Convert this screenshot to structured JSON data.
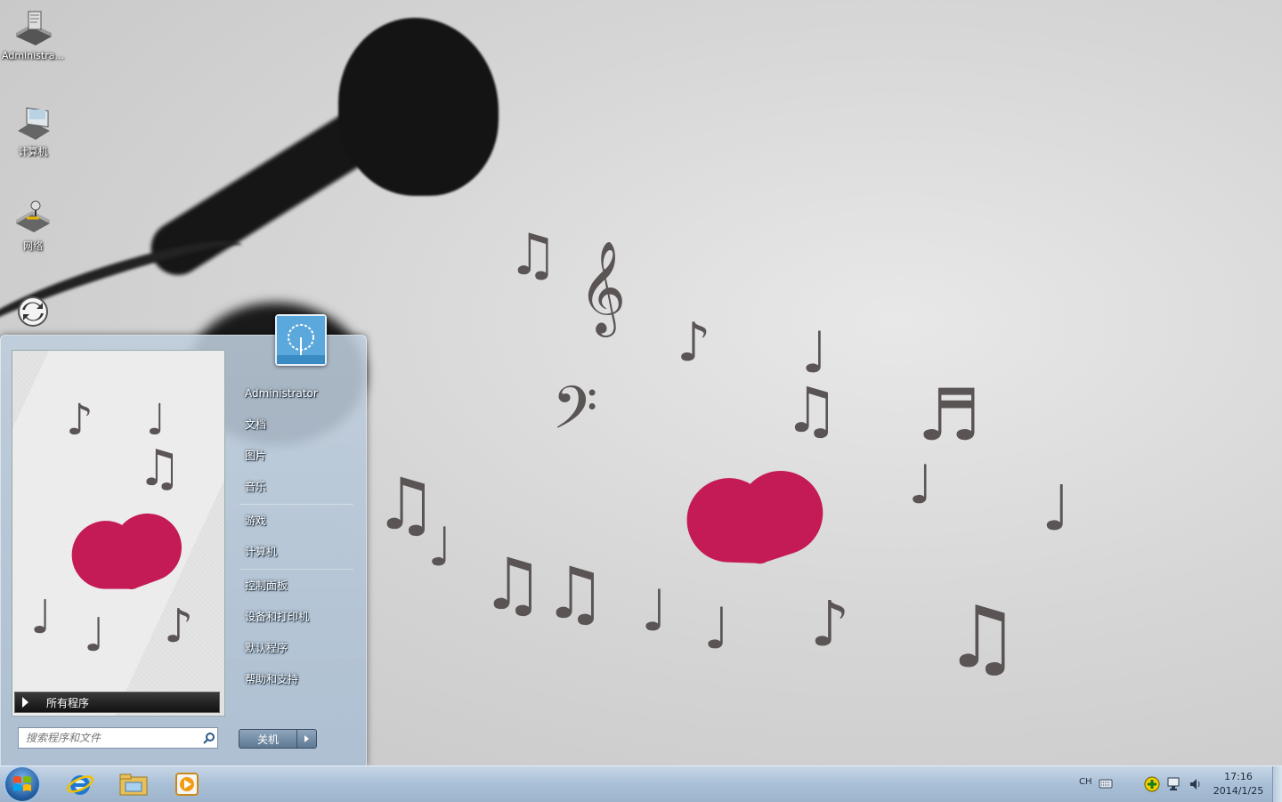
{
  "desktop": {
    "icons": [
      {
        "label": "Administra...",
        "icon": "user-folder-icon"
      },
      {
        "label": "计算机",
        "icon": "computer-icon"
      },
      {
        "label": "网络",
        "icon": "network-icon"
      },
      {
        "label": "",
        "icon": "sync-icon"
      }
    ]
  },
  "start_menu": {
    "user_name": "Administrator",
    "items": [
      "文档",
      "图片",
      "音乐",
      "游戏",
      "计算机",
      "控制面板",
      "设备和打印机",
      "默认程序",
      "帮助和支持"
    ],
    "all_programs_label": "所有程序",
    "search_placeholder": "搜索程序和文件",
    "shutdown_label": "关机"
  },
  "taskbar": {
    "pinned": [
      "internet-explorer-icon",
      "file-explorer-icon",
      "media-player-icon"
    ],
    "language": "CH",
    "time": "17:16",
    "date": "2014/1/25"
  },
  "colors": {
    "taskbar": "#a9bfd6",
    "wallpaper_heart": "#c41a55"
  }
}
